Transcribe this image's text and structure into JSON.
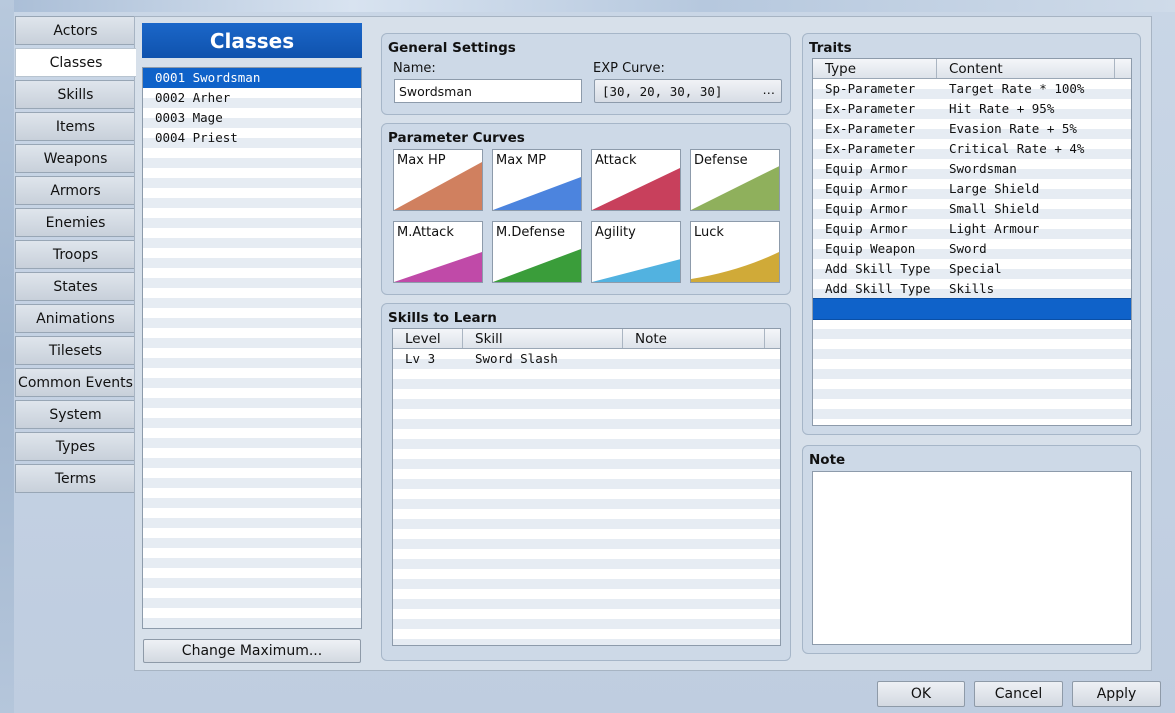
{
  "tabs": [
    {
      "label": "Actors"
    },
    {
      "label": "Classes",
      "active": true
    },
    {
      "label": "Skills"
    },
    {
      "label": "Items"
    },
    {
      "label": "Weapons"
    },
    {
      "label": "Armors"
    },
    {
      "label": "Enemies"
    },
    {
      "label": "Troops"
    },
    {
      "label": "States"
    },
    {
      "label": "Animations"
    },
    {
      "label": "Tilesets"
    },
    {
      "label": "Common Events"
    },
    {
      "label": "System"
    },
    {
      "label": "Types"
    },
    {
      "label": "Terms"
    }
  ],
  "class_panel": {
    "title": "Classes",
    "items": [
      "0001 Swordsman",
      "0002 Arher",
      "0003 Mage",
      "0004 Priest"
    ],
    "selected_index": 0,
    "change_max_label": "Change Maximum..."
  },
  "general": {
    "title": "General Settings",
    "name_label": "Name:",
    "name_value": "Swordsman",
    "exp_label": "EXP Curve:",
    "exp_value": "[30, 20, 30, 30]",
    "exp_button": "…"
  },
  "param_curves": {
    "title": "Parameter Curves",
    "curves": [
      {
        "label": "Max HP",
        "color": "#d0805f",
        "start": 0.0,
        "end": 0.8,
        "bend": 0.0
      },
      {
        "label": "Max MP",
        "color": "#4c84de",
        "start": 0.0,
        "end": 0.55,
        "bend": 0.0
      },
      {
        "label": "Attack",
        "color": "#c8405c",
        "start": 0.0,
        "end": 0.7,
        "bend": 0.0
      },
      {
        "label": "Defense",
        "color": "#8fb05c",
        "start": 0.0,
        "end": 0.73,
        "bend": 0.0
      },
      {
        "label": "M.Attack",
        "color": "#c04aa8",
        "start": 0.0,
        "end": 0.5,
        "bend": 0.0
      },
      {
        "label": "M.Defense",
        "color": "#3a9d3a",
        "start": 0.0,
        "end": 0.55,
        "bend": 0.0
      },
      {
        "label": "Agility",
        "color": "#52b2e0",
        "start": 0.0,
        "end": 0.38,
        "bend": 0.0
      },
      {
        "label": "Luck",
        "color": "#d0aa38",
        "start": 0.05,
        "end": 0.5,
        "bend": 0.35
      }
    ]
  },
  "skills": {
    "title": "Skills to Learn",
    "headers": [
      "Level",
      "Skill",
      "Note"
    ],
    "rows": [
      {
        "level": "Lv  3",
        "skill": "Sword Slash",
        "note": ""
      }
    ]
  },
  "traits": {
    "title": "Traits",
    "headers": [
      "Type",
      "Content"
    ],
    "rows": [
      {
        "type": "Sp-Parameter",
        "content": "Target Rate * 100%"
      },
      {
        "type": "Ex-Parameter",
        "content": "Hit Rate + 95%"
      },
      {
        "type": "Ex-Parameter",
        "content": "Evasion Rate + 5%"
      },
      {
        "type": "Ex-Parameter",
        "content": "Critical Rate + 4%"
      },
      {
        "type": "Equip Armor",
        "content": "Swordsman"
      },
      {
        "type": "Equip Armor",
        "content": "Large Shield"
      },
      {
        "type": "Equip Armor",
        "content": "Small Shield"
      },
      {
        "type": "Equip Armor",
        "content": "Light Armour"
      },
      {
        "type": "Equip Weapon",
        "content": "Sword"
      },
      {
        "type": "Add Skill Type",
        "content": "Special"
      },
      {
        "type": "Add Skill Type",
        "content": "Skills"
      },
      {
        "type": "",
        "content": "",
        "selected": true
      }
    ]
  },
  "note": {
    "title": "Note",
    "value": ""
  },
  "footer": {
    "ok": "OK",
    "cancel": "Cancel",
    "apply": "Apply"
  },
  "colors": {
    "selection": "#0f62c9",
    "header_blue": "#1b67c9"
  }
}
